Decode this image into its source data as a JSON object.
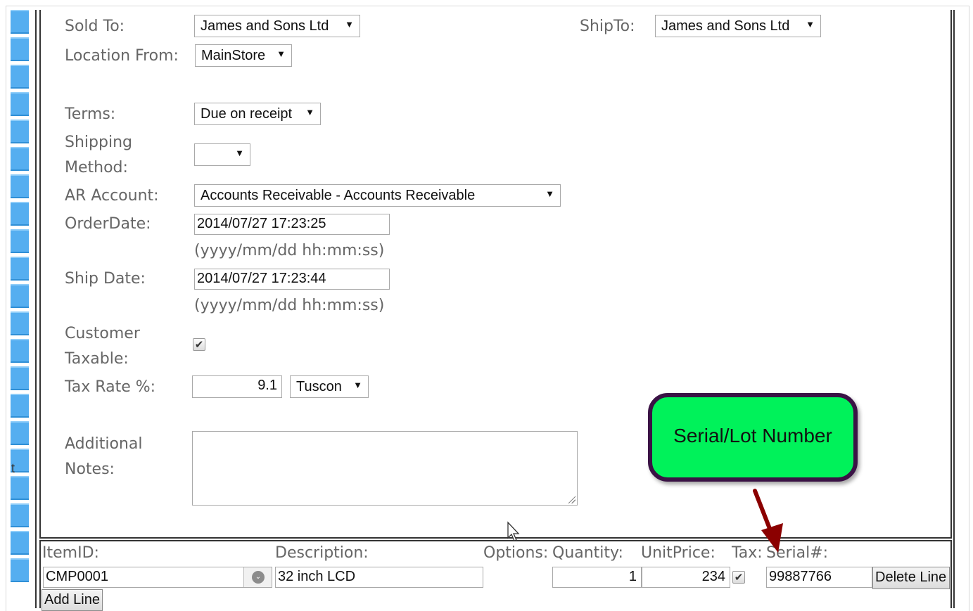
{
  "form": {
    "sold_to": {
      "label": "Sold To:",
      "value": "James and Sons Ltd"
    },
    "ship_to": {
      "label": "ShipTo:",
      "value": "James and Sons Ltd"
    },
    "location_from": {
      "label": "Location From:",
      "value": "MainStore"
    },
    "terms": {
      "label": "Terms:",
      "value": "Due on receipt"
    },
    "shipping_method": {
      "label_line1": "Shipping",
      "label_line2": "Method:",
      "value": ""
    },
    "ar_account": {
      "label": "AR Account:",
      "value": "Accounts Receivable - Accounts Receivable"
    },
    "order_date": {
      "label": "OrderDate:",
      "value": "2014/07/27 17:23:25",
      "hint": "(yyyy/mm/dd hh:mm:ss)"
    },
    "ship_date": {
      "label": "Ship Date:",
      "value": "2014/07/27 17:23:44",
      "hint": "(yyyy/mm/dd hh:mm:ss)"
    },
    "customer_taxable": {
      "label_line1": "Customer",
      "label_line2": "Taxable:",
      "checked": true,
      "check_glyph": "✔"
    },
    "tax_rate": {
      "label": "Tax Rate %:",
      "value": "9.1",
      "region": "Tuscon"
    },
    "additional_notes": {
      "label_line1": "Additional",
      "label_line2": "Notes:",
      "value": ""
    }
  },
  "line_items": {
    "headers": {
      "item_id": "ItemID:",
      "description": "Description:",
      "options": "Options:",
      "quantity": "Quantity:",
      "unit_price": "UnitPrice:",
      "tax": "Tax:",
      "serial": "Serial#:"
    },
    "rows": [
      {
        "item_id": "CMP0001",
        "description": "32 inch LCD",
        "quantity": "1",
        "unit_price": "234",
        "tax_checked": true,
        "serial": "99887766",
        "delete_label": "Delete Line"
      }
    ],
    "add_line_label": "Add Line"
  },
  "left_strip": {
    "glyph": "t"
  },
  "callout": {
    "text": "Serial/Lot Number",
    "fill_color": "#00f25a",
    "border_color": "#3a1245"
  },
  "arrow": {
    "color": "#8b0000"
  },
  "icons": {
    "dropdown_arrow": "▼",
    "combo_icon": "⌄"
  }
}
